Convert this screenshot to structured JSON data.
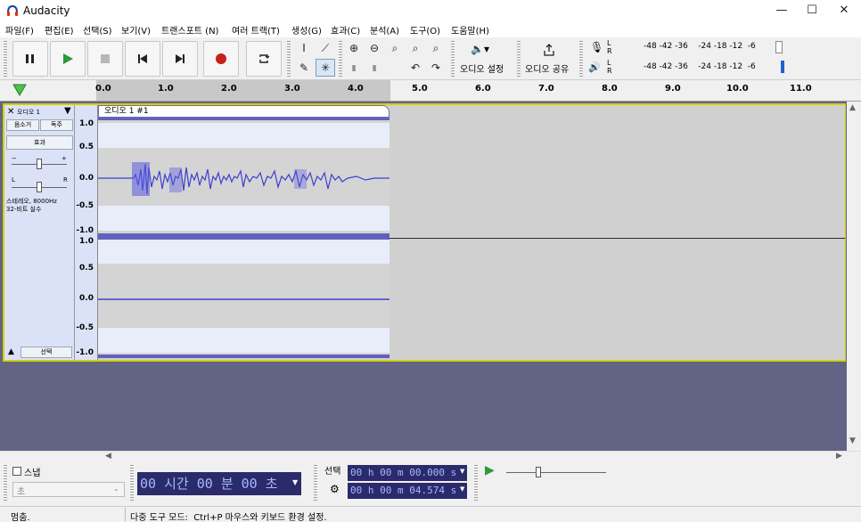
{
  "app": {
    "title": "Audacity",
    "icon": "audacity-headphones-icon"
  },
  "window_controls": {
    "minimize": "—",
    "maximize": "☐",
    "close": "✕"
  },
  "menu": [
    "파일(F)",
    "편집(E)",
    "선택(S)",
    "보기(V)",
    "트랜스포트 (N)",
    "여러 트랙(T)",
    "생성(G)",
    "효과(C)",
    "분석(A)",
    "도구(O)",
    "도움말(H)"
  ],
  "toolbar": {
    "audio_setup_label": "오디오 설정",
    "share_audio_label": "오디오 공유",
    "meter_scale_rec": "-48 -42 -36    -24 -18 -12  -6",
    "meter_scale_play": "-48 -42 -36    -24 -18 -12  -6",
    "meter_lr_top": "L",
    "meter_lr_bottom": "R"
  },
  "ruler": {
    "ticks": [
      "0.0",
      "1.0",
      "2.0",
      "3.0",
      "4.0",
      "5.0",
      "6.0",
      "7.0",
      "8.0",
      "9.0",
      "10.0",
      "11.0"
    ]
  },
  "track": {
    "name": "오디오 1",
    "mute_label": "음소거",
    "solo_label": "독주",
    "effects_label": "효과",
    "gain_minus": "−",
    "gain_plus": "+",
    "pan_left": "L",
    "pan_right": "R",
    "info": "스테레오, 8000Hz\n32-비트 실수",
    "select_label": "선택",
    "clip_name": "오디오 1 #1",
    "scale_top": [
      "1.0",
      "0.5",
      "0.0",
      "-0.5",
      "-1.0"
    ],
    "scale_bottom": [
      "1.0",
      "0.5",
      "0.0",
      "-0.5",
      "-1.0"
    ]
  },
  "bottom": {
    "snap_label": "스냅",
    "snap_unit": "초",
    "time_display": "00 시간 00 분 00 초",
    "selection_label": "선택",
    "sel_start": "00 h 00 m 00.000 s",
    "sel_end": "00 h 00 m 04.574 s"
  },
  "status": {
    "left": "멈춤.",
    "right": "다중 도구 모드:  Ctrl+P 마우스와 키보드 환경 설정."
  }
}
